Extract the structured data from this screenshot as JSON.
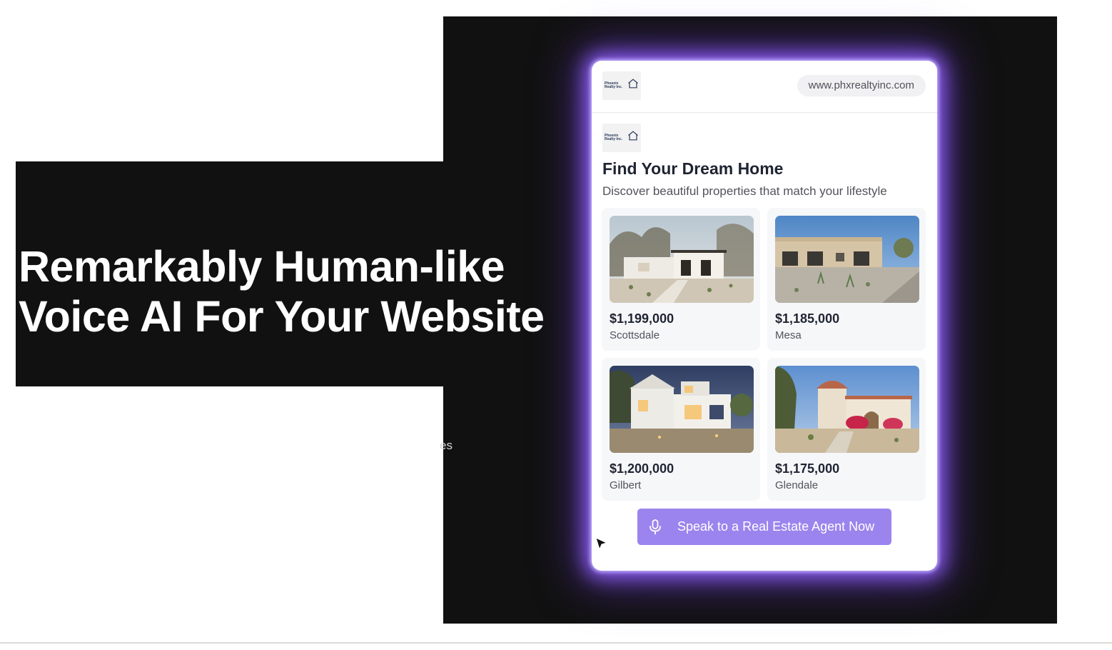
{
  "hero": {
    "line1": "Remarkably Human-like",
    "line2": "Voice AI For Your Website",
    "stray_fragment": "es"
  },
  "widget": {
    "logo_text": "Phoenix\nRealty Inc.",
    "url": "www.phxrealtyinc.com",
    "title": "Find Your Dream Home",
    "subtitle": "Discover beautiful properties that match your lifestyle",
    "listings": [
      {
        "price": "$1,199,000",
        "city": "Scottsdale",
        "image_icon": "house-photo-icon"
      },
      {
        "price": "$1,185,000",
        "city": "Mesa",
        "image_icon": "house-photo-icon"
      },
      {
        "price": "$1,200,000",
        "city": "Gilbert",
        "image_icon": "house-photo-icon"
      },
      {
        "price": "$1,175,000",
        "city": "Glendale",
        "image_icon": "house-photo-icon"
      }
    ],
    "cta_label": "Speak to a Real Estate Agent Now",
    "cta_icon": "microphone-icon"
  },
  "colors": {
    "dark_bg": "#111111",
    "accent_purple": "#9b84ee",
    "glow_purple": "#8a5cf0",
    "text_dark": "#1f2432",
    "text_muted": "#52525b"
  }
}
